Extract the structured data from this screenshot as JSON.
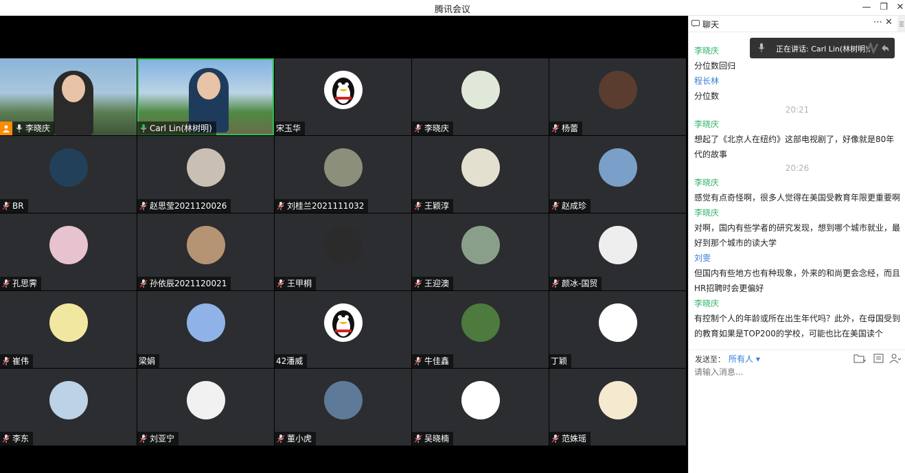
{
  "window": {
    "title": "腾讯会议",
    "minimize": "—",
    "restore": "❐",
    "close": "✕"
  },
  "participants": [
    {
      "name": "李晓庆",
      "host": true
    },
    {
      "name": "Carl Lin(林树明)",
      "active": true
    },
    {
      "name": "宋玉华"
    },
    {
      "name": "李晓庆"
    },
    {
      "name": "杨蕾"
    },
    {
      "name": "BR"
    },
    {
      "name": "赵思莹2021120026"
    },
    {
      "name": "刘桂兰2021111032"
    },
    {
      "name": "王颖淳"
    },
    {
      "name": "赵成珍"
    },
    {
      "name": "孔思霁"
    },
    {
      "name": "孙依辰2021120021"
    },
    {
      "name": "王甲桐"
    },
    {
      "name": "王迎澳"
    },
    {
      "name": "颜冰-国贸"
    },
    {
      "name": "崔伟"
    },
    {
      "name": "梁娟"
    },
    {
      "name": "42潘威"
    },
    {
      "name": "牛佳鑫"
    },
    {
      "name": "丁颖"
    },
    {
      "name": "李东"
    },
    {
      "name": "刘亚宁"
    },
    {
      "name": "董小虎"
    },
    {
      "name": "吴晓楠"
    },
    {
      "name": "范姝瑶"
    }
  ],
  "chat": {
    "title": "聊天",
    "more": "⋯",
    "close": "✕",
    "speaking": "正在讲话: Carl Lin(林树明);",
    "messages": [
      {
        "sender": "李晓庆",
        "color": "#2fb36a",
        "text": "分位数回归"
      },
      {
        "sender": "程长林",
        "color": "#3a7fd5",
        "text": "分位数"
      },
      {
        "time": "20:21"
      },
      {
        "sender": "李晓庆",
        "color": "#2fb36a",
        "text": "想起了《北京人在纽约》这部电视剧了，好像就是80年代的故事"
      },
      {
        "time": "20:26"
      },
      {
        "sender": "李晓庆",
        "color": "#2fb36a",
        "text": "感觉有点奇怪啊，很多人觉得在美国受教育年限更重要啊"
      },
      {
        "sender": "李晓庆",
        "color": "#2fb36a",
        "text": "对啊，国内有些学者的研究发现，想到哪个城市就业，最好到那个城市的读大学"
      },
      {
        "sender": "刘雯",
        "color": "#3a7fd5",
        "text": "但国内有些地方也有种现象，外来的和尚更会念经，而且HR招聘时会更偏好"
      },
      {
        "sender": "李晓庆",
        "color": "#2fb36a",
        "text": "有控制个人的年龄或所在出生年代吗？此外，在母国受到的教育如果是TOP200的学校，可能也比在美国读个"
      }
    ],
    "send_to_label": "发送至：",
    "send_to_value": "所有人 ▾",
    "input_placeholder": "请输入消息..."
  },
  "colors": {
    "accent_green": "#2fbf55",
    "host_orange": "#ff8a00",
    "link_blue": "#2d7be5"
  }
}
